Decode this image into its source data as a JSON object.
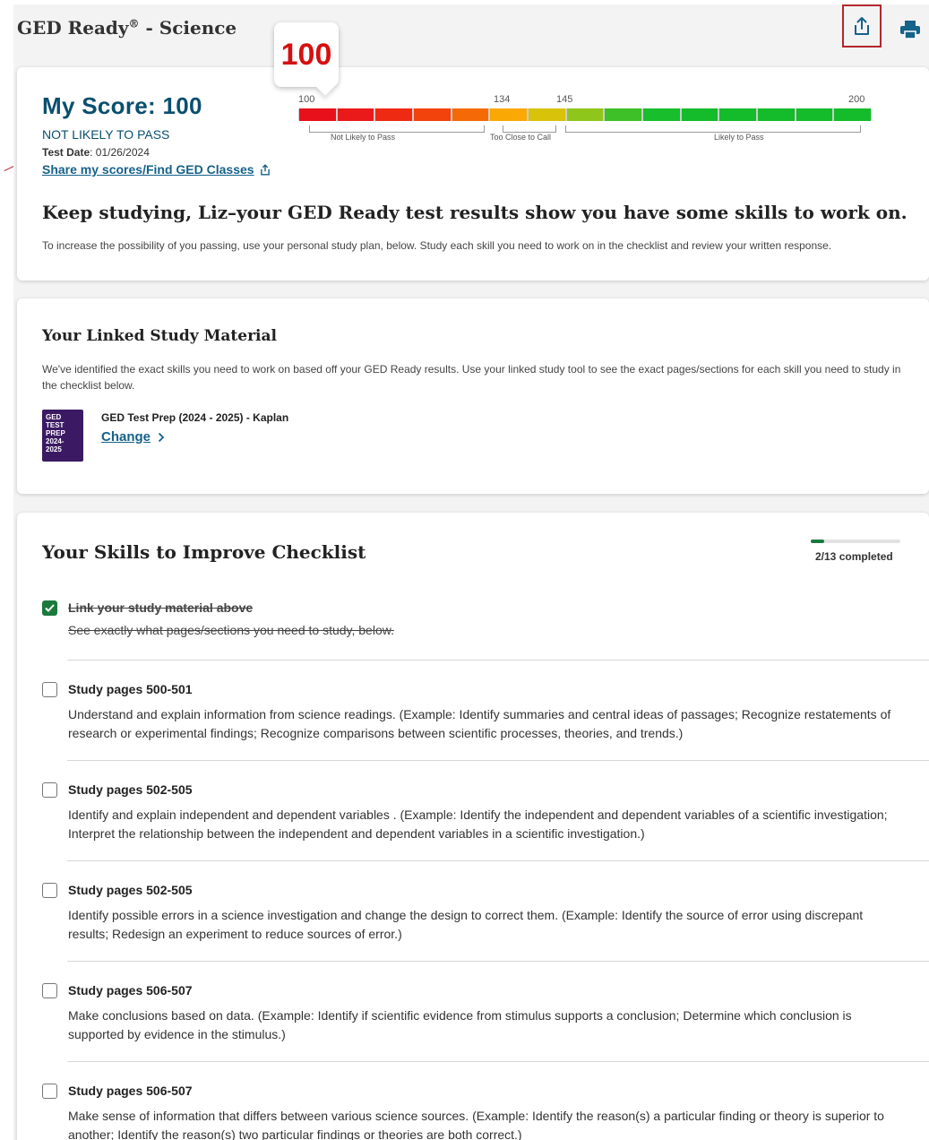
{
  "header": {
    "title": "GED Ready",
    "title_mark": "®",
    "title_suffix": " - Science",
    "share_icon": "share-icon",
    "print_icon": "printer-icon"
  },
  "score": {
    "bubble_value": "100",
    "heading": "My Score: 100",
    "status": "NOT LIKELY TO PASS",
    "test_date_label": "Test Date",
    "test_date_value": ": 01/26/2024",
    "share_link": "Share my scores/Find GED Classes",
    "headline": "Keep studying, Liz–your GED Ready test results show you have some skills to work on.",
    "subtext": "To increase the possibility of you passing, use your personal study plan, below. Study each skill you need to work on in the checklist and review your written response.",
    "gauge": {
      "min": "100",
      "t1": "134",
      "t2": "145",
      "max": "200",
      "range1": "Not Likely to Pass",
      "range2": "Too Close to Call",
      "range3": "Likely to Pass",
      "segment_colors": [
        "#e8101b",
        "#ea1a1a",
        "#ee2a12",
        "#f2430c",
        "#f56a07",
        "#f9a804",
        "#d9c20a",
        "#8fc61c",
        "#3dc028",
        "#18be2c",
        "#14bb2b",
        "#14bb2b",
        "#14bb2b",
        "#14bb2b",
        "#14bb2b"
      ]
    }
  },
  "study": {
    "title": "Your Linked Study Material",
    "description": "We've identified the exact skills you need to work on based off your GED Ready results. Use your linked study tool to see the exact pages/sections for each skill you need to study in the checklist below.",
    "book_cover_text": "GED TEST PREP 2024-2025",
    "book_title": "GED Test Prep (2024 - 2025) - Kaplan",
    "change_label": "Change"
  },
  "checklist": {
    "title": "Your Skills to Improve Checklist",
    "progress_label": "2/13 completed",
    "progress_fraction": 0.1538,
    "items": [
      {
        "title": "Link your study material above",
        "desc": "See exactly what pages/sections you need to study, below.",
        "checked": true
      },
      {
        "title": "Study pages 500-501",
        "desc": "Understand and explain information from science readings. (Example: Identify summaries and central ideas of passages; Recognize restatements of research or experimental findings; Recognize comparisons between scientific processes, theories, and trends.)",
        "checked": false
      },
      {
        "title": "Study pages 502-505",
        "desc": "Identify and explain independent and dependent variables . (Example: Identify the independent and dependent variables of a scientific investigation; Interpret the relationship between the independent and dependent variables in a scientific investigation.)",
        "checked": false
      },
      {
        "title": "Study pages 502-505",
        "desc": "Identify possible errors in a science investigation and change the design to correct them. (Example: Identify the source of error using discrepant results; Redesign an experiment to reduce sources of error.)",
        "checked": false
      },
      {
        "title": "Study pages 506-507",
        "desc": "Make conclusions based on data. (Example: Identify if scientific evidence from stimulus supports a conclusion; Determine which conclusion is supported by evidence in the stimulus.)",
        "checked": false
      },
      {
        "title": "Study pages 506-507",
        "desc": "Make sense of information that differs between various science sources. (Example: Identify the reason(s) a particular finding or theory is superior to another; Identify the reason(s) two particular findings or theories are both correct.)",
        "checked": false
      }
    ]
  }
}
